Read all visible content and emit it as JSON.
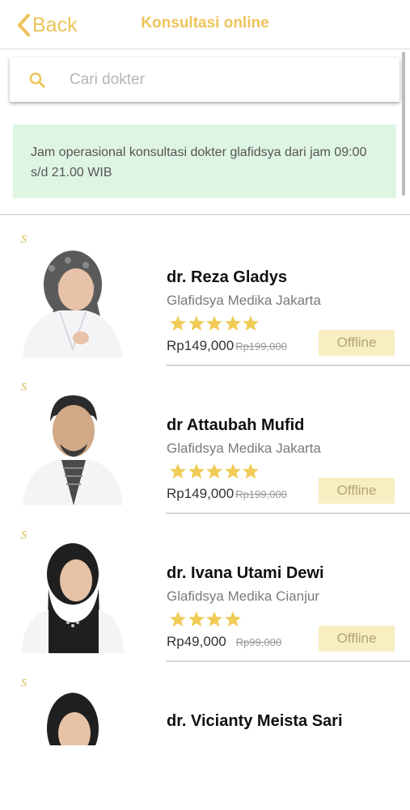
{
  "header": {
    "back_label": "Back",
    "title": "Konsultasi online"
  },
  "search": {
    "placeholder": "Cari dokter"
  },
  "notice": {
    "text": "Jam operasional konsultasi dokter glafidsya dari jam 09:00 s/d 21.00 WIB"
  },
  "colors": {
    "accent": "#ecc45b",
    "notice_bg": "#dff5e4",
    "offline_bg": "#f7eec1"
  },
  "doctors": [
    {
      "logo": "S",
      "name": "dr. Reza Gladys",
      "clinic": "Glafidsya Medika Jakarta",
      "rating": 5,
      "price": "Rp149,000",
      "old_price": "Rp199,000",
      "status": "Offline"
    },
    {
      "logo": "S",
      "name": "dr Attaubah Mufid",
      "clinic": "Glafidsya Medika Jakarta",
      "rating": 5,
      "price": "Rp149,000",
      "old_price": "Rp199,000",
      "status": "Offline"
    },
    {
      "logo": "S",
      "name": "dr. Ivana Utami Dewi",
      "clinic": "Glafidsya Medika Cianjur",
      "rating": 4,
      "price": "Rp49,000",
      "old_price": "Rp99,000",
      "status": "Offline"
    },
    {
      "logo": "S",
      "name": "dr. Vicianty Meista Sari"
    }
  ]
}
